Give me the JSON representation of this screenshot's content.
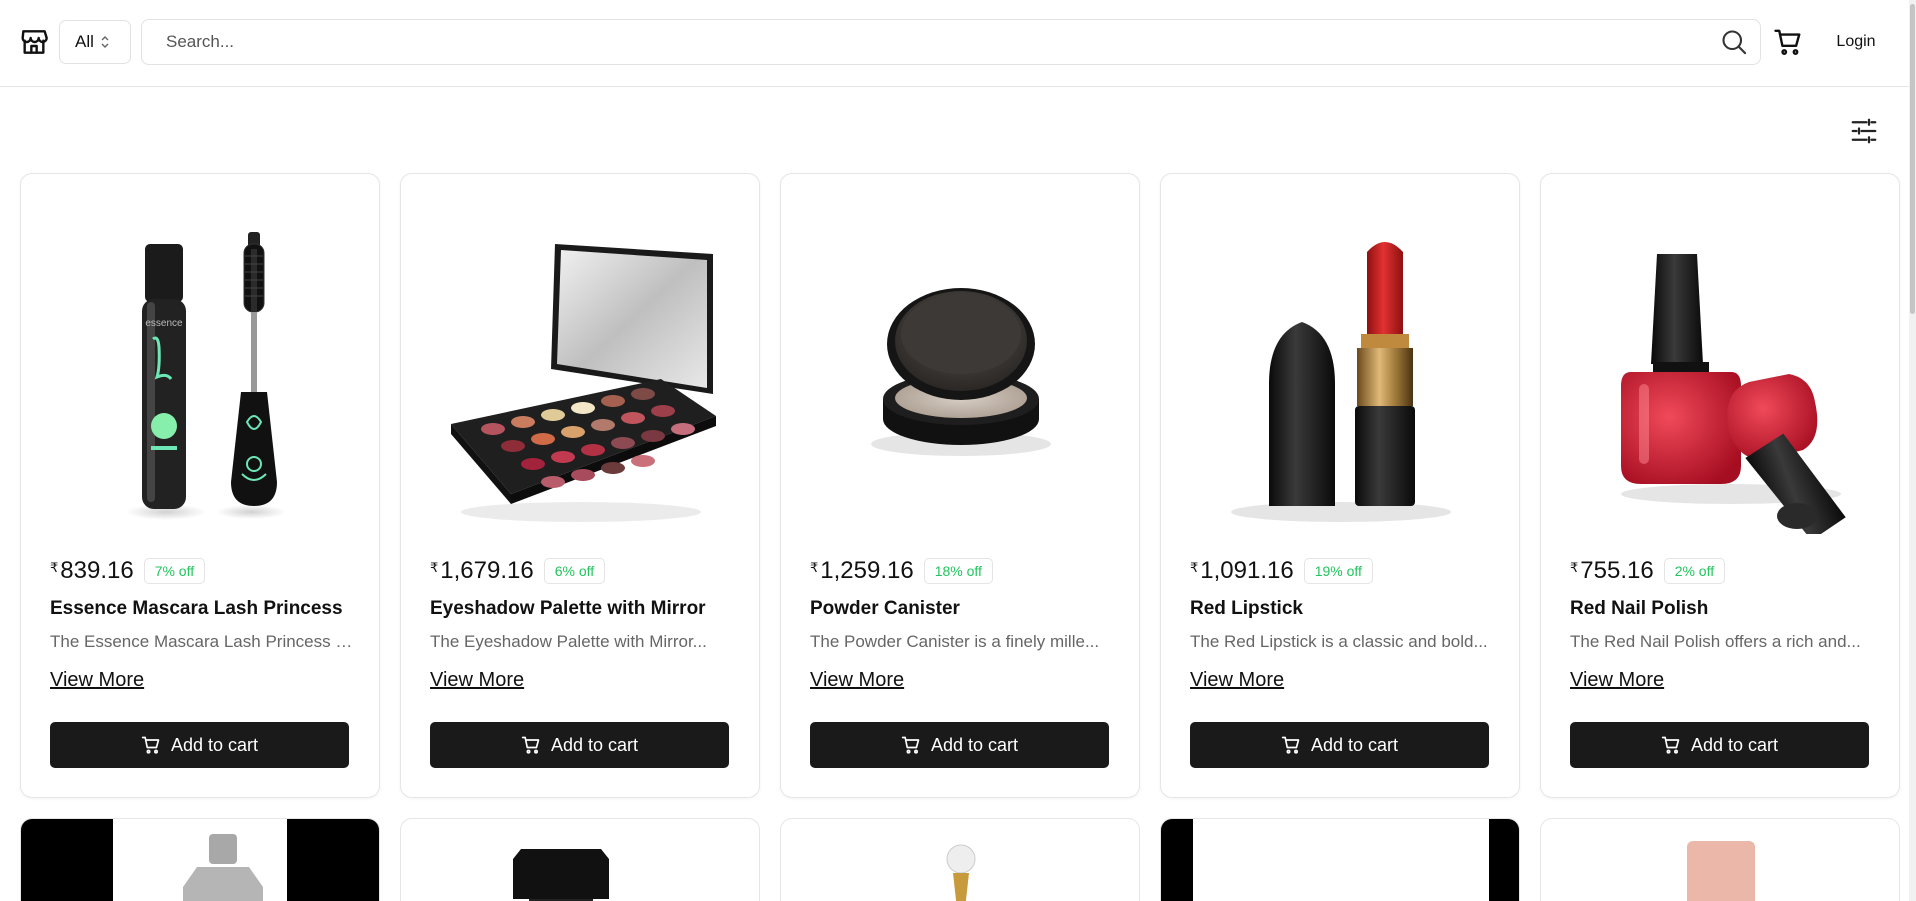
{
  "header": {
    "category_value": "All",
    "search_placeholder": "Search...",
    "login_label": "Login"
  },
  "products": [
    {
      "currency": "₹",
      "price": "839.16",
      "discount": "7% off",
      "title": "Essence Mascara Lash Princess",
      "desc": "The Essence Mascara Lash Princess is...",
      "view_more": "View More",
      "add_label": "Add to cart",
      "logo_text": "essence"
    },
    {
      "currency": "₹",
      "price": "1,679.16",
      "discount": "6% off",
      "title": "Eyeshadow Palette with Mirror",
      "desc": "The Eyeshadow Palette with Mirror...",
      "view_more": "View More",
      "add_label": "Add to cart"
    },
    {
      "currency": "₹",
      "price": "1,259.16",
      "discount": "18% off",
      "title": "Powder Canister",
      "desc": "The Powder Canister is a finely mille...",
      "view_more": "View More",
      "add_label": "Add to cart"
    },
    {
      "currency": "₹",
      "price": "1,091.16",
      "discount": "19% off",
      "title": "Red Lipstick",
      "desc": "The Red Lipstick is a classic and bold...",
      "view_more": "View More",
      "add_label": "Add to cart"
    },
    {
      "currency": "₹",
      "price": "755.16",
      "discount": "2% off",
      "title": "Red Nail Polish",
      "desc": "The Red Nail Polish offers a rich and...",
      "view_more": "View More",
      "add_label": "Add to cart"
    }
  ],
  "colors": {
    "discount": "#22c55e",
    "button_bg": "#1a1a1a",
    "lipstick_red": "#d01e1e",
    "nail_red": "#c8102e"
  },
  "icons": [
    "store-icon",
    "chevron-updown-icon",
    "search-icon",
    "cart-icon",
    "filter-icon"
  ]
}
